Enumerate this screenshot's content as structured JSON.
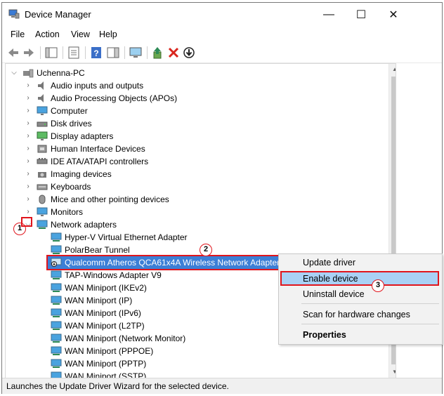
{
  "window": {
    "title": "Device Manager",
    "minimize": "—",
    "maximize": "☐",
    "close": "✕"
  },
  "menu": [
    "File",
    "Action",
    "View",
    "Help"
  ],
  "toolbar": [
    "back-icon",
    "forward-icon",
    "console-tree-icon",
    "properties-icon",
    "help-icon",
    "action-pane-icon",
    "monitor-scan-icon",
    "update-driver-icon",
    "uninstall-icon",
    "disable-icon"
  ],
  "tree": {
    "root": "Uchenna-PC",
    "categories": [
      "Audio inputs and outputs",
      "Audio Processing Objects (APOs)",
      "Computer",
      "Disk drives",
      "Display adapters",
      "Human Interface Devices",
      "IDE ATA/ATAPI controllers",
      "Imaging devices",
      "Keyboards",
      "Mice and other pointing devices",
      "Monitors",
      "Network adapters"
    ],
    "network_adapters": [
      "Hyper-V Virtual Ethernet Adapter",
      "PolarBear Tunnel",
      "Qualcomm Atheros QCA61x4A Wireless Network Adapter",
      "TAP-Windows Adapter V9",
      "WAN Miniport (IKEv2)",
      "WAN Miniport (IP)",
      "WAN Miniport (IPv6)",
      "WAN Miniport (L2TP)",
      "WAN Miniport (Network Monitor)",
      "WAN Miniport (PPPOE)",
      "WAN Miniport (PPTP)",
      "WAN Miniport (SSTP)"
    ]
  },
  "context_menu": {
    "update": "Update driver",
    "enable": "Enable device",
    "uninstall": "Uninstall device",
    "scan": "Scan for hardware changes",
    "properties": "Properties"
  },
  "callouts": [
    "1",
    "2",
    "3"
  ],
  "status": "Launches the Update Driver Wizard for the selected device.",
  "colors": {
    "highlight": "#a9d1f5",
    "callout_red": "#e0151c"
  }
}
